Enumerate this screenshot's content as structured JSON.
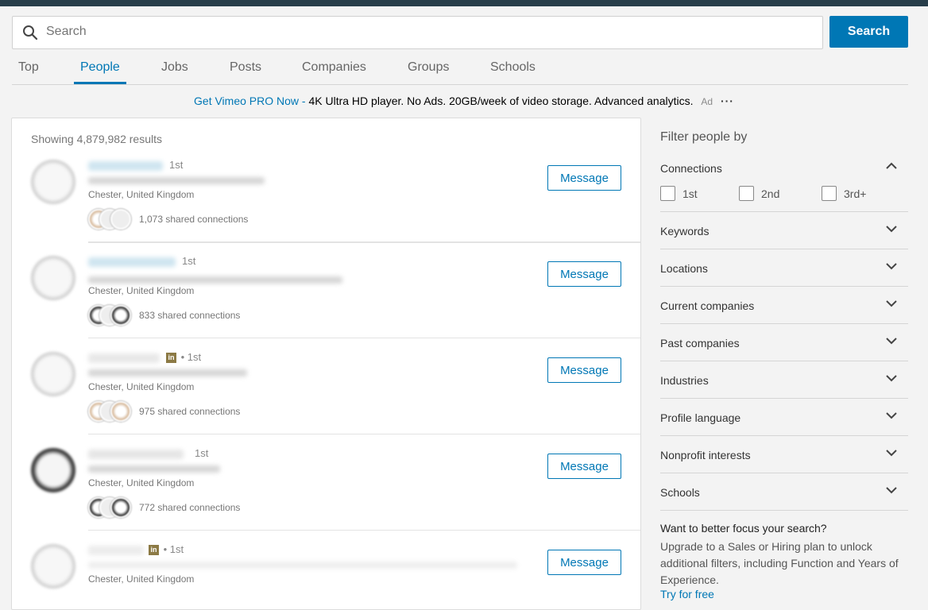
{
  "search": {
    "placeholder": "Search",
    "button_label": "Search"
  },
  "tabs": [
    {
      "label": "Top"
    },
    {
      "label": "People",
      "active": true
    },
    {
      "label": "Jobs"
    },
    {
      "label": "Posts"
    },
    {
      "label": "Companies"
    },
    {
      "label": "Groups"
    },
    {
      "label": "Schools"
    }
  ],
  "ad": {
    "link_text": "Get Vimeo PRO Now -",
    "body": "4K Ultra HD player. No Ads. 20GB/week of video storage. Advanced analytics.",
    "tag": "Ad",
    "more": "···"
  },
  "results": {
    "count_text": "Showing 4,879,982 results",
    "items": [
      {
        "degree": "1st",
        "location": "Chester, United Kingdom",
        "shared": "1,073 shared connections",
        "action": "Message"
      },
      {
        "degree": "1st",
        "location": "Chester, United Kingdom",
        "shared": "833 shared connections",
        "action": "Message"
      },
      {
        "degree": "• 1st",
        "location": "Chester, United Kingdom",
        "shared": "975 shared connections",
        "action": "Message",
        "premium": true
      },
      {
        "degree": "1st",
        "location": "Chester, United Kingdom",
        "shared": "772 shared connections",
        "action": "Message"
      },
      {
        "degree": "• 1st",
        "location": "Chester, United Kingdom",
        "shared": "",
        "action": "Message",
        "premium": true
      }
    ]
  },
  "filters": {
    "title": "Filter people by",
    "connections": {
      "label": "Connections",
      "options": [
        "1st",
        "2nd",
        "3rd+"
      ]
    },
    "sections": [
      "Keywords",
      "Locations",
      "Current companies",
      "Past companies",
      "Industries",
      "Profile language",
      "Nonprofit interests",
      "Schools"
    ],
    "upsell": {
      "title": "Want to better focus your search?",
      "body": "Upgrade to a Sales or Hiring plan to unlock additional filters, including Function and Years of Experience.",
      "link": "Try for free"
    }
  },
  "colors": {
    "accent": "#0077b5",
    "topbar": "#283e4a",
    "premium_badge": "#8c7a45"
  },
  "icons": {
    "badge_text": "in"
  }
}
